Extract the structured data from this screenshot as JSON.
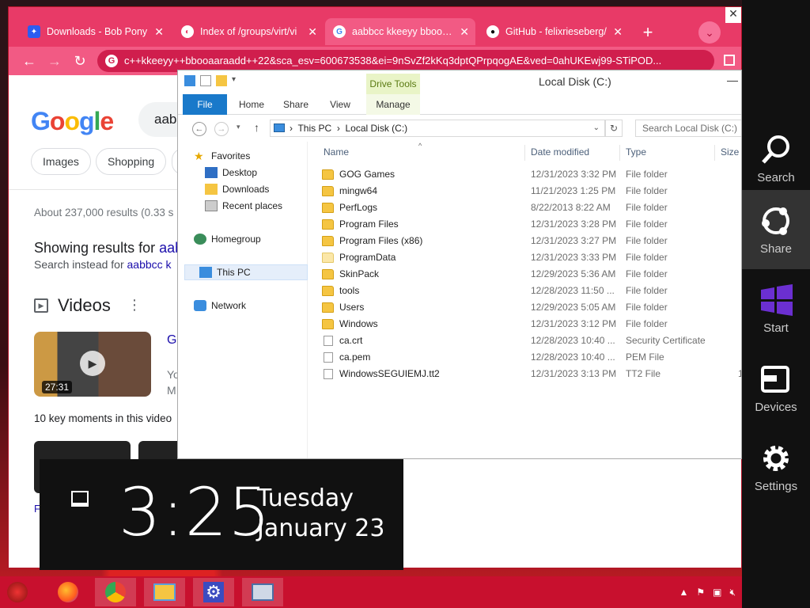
{
  "browser": {
    "tabs": [
      {
        "title": "Downloads - Bob Pony",
        "icon": "bob-pony-favicon"
      },
      {
        "title": "Index of /groups/virt/vi",
        "icon": "index-favicon"
      },
      {
        "title": "aabbcc kkeeyy bbooaar",
        "icon": "google-favicon",
        "active": true
      },
      {
        "title": "GitHub - felixrieseberg/",
        "icon": "github-favicon"
      }
    ],
    "new_tab_label": "+",
    "url": "c++kkeeyy++bbooaaraadd++22&sca_esv=600673538&ei=9nSvZf2kKq3dptQPrpqogAE&ved=0ahUKEwj99-STiPOD...",
    "accent_color": "#e83a67"
  },
  "google": {
    "logo": "Google",
    "search_value": "aabbcc kkeeyy bbooaar",
    "chips": [
      "Images",
      "Shopping"
    ],
    "result_stats": "About 237,000 results (0.33 s",
    "showing_prefix": "Showing results for ",
    "showing_query": "aab",
    "instead_prefix": "Search instead for ",
    "instead_query": "aabbcc k",
    "videos_heading": "Videos",
    "video_duration": "27:31",
    "video_title": "Ga",
    "video_line1": "Yo",
    "video_line2": "M",
    "key_moments": "10 key moments in this video",
    "footer_letter": "F"
  },
  "explorer": {
    "window_title": "Local Disk (C:)",
    "contextual_tab": "Drive Tools",
    "ribbon_tabs": [
      "File",
      "Home",
      "Share",
      "View",
      "Manage"
    ],
    "breadcrumb": [
      "This PC",
      "Local Disk (C:)"
    ],
    "search_placeholder": "Search Local Disk (C:)",
    "nav": {
      "favorites": "Favorites",
      "desktop": "Desktop",
      "downloads": "Downloads",
      "recent": "Recent places",
      "homegroup": "Homegroup",
      "thispc": "This PC",
      "network": "Network"
    },
    "columns": {
      "name": "Name",
      "date": "Date modified",
      "type": "Type",
      "size": "Size"
    },
    "files": [
      {
        "name": "GOG Games",
        "date": "12/31/2023 3:32 PM",
        "type": "File folder",
        "size": "",
        "kind": "folder"
      },
      {
        "name": "mingw64",
        "date": "11/21/2023 1:25 PM",
        "type": "File folder",
        "size": "",
        "kind": "folder"
      },
      {
        "name": "PerfLogs",
        "date": "8/22/2013 8:22 AM",
        "type": "File folder",
        "size": "",
        "kind": "folder"
      },
      {
        "name": "Program Files",
        "date": "12/31/2023 3:28 PM",
        "type": "File folder",
        "size": "",
        "kind": "folder"
      },
      {
        "name": "Program Files (x86)",
        "date": "12/31/2023 3:27 PM",
        "type": "File folder",
        "size": "",
        "kind": "folder"
      },
      {
        "name": "ProgramData",
        "date": "12/31/2023 3:33 PM",
        "type": "File folder",
        "size": "",
        "kind": "folder-hidden"
      },
      {
        "name": "SkinPack",
        "date": "12/29/2023 5:36 AM",
        "type": "File folder",
        "size": "",
        "kind": "folder"
      },
      {
        "name": "tools",
        "date": "12/28/2023 11:50 ...",
        "type": "File folder",
        "size": "",
        "kind": "folder"
      },
      {
        "name": "Users",
        "date": "12/29/2023 5:05 AM",
        "type": "File folder",
        "size": "",
        "kind": "folder"
      },
      {
        "name": "Windows",
        "date": "12/31/2023 3:12 PM",
        "type": "File folder",
        "size": "",
        "kind": "folder"
      },
      {
        "name": "ca.crt",
        "date": "12/28/2023 10:40 ...",
        "type": "Security Certificate",
        "size": "",
        "kind": "file"
      },
      {
        "name": "ca.pem",
        "date": "12/28/2023 10:40 ...",
        "type": "PEM File",
        "size": "",
        "kind": "file"
      },
      {
        "name": "WindowsSEGUIEMJ.tt2",
        "date": "12/31/2023 3:13 PM",
        "type": "TT2 File",
        "size": "1",
        "kind": "file"
      }
    ]
  },
  "clock": {
    "time": "3:25",
    "day": "Tuesday",
    "date": "January 23"
  },
  "charms": [
    {
      "label": "Search",
      "icon": "search-icon"
    },
    {
      "label": "Share",
      "icon": "share-icon",
      "hover": true
    },
    {
      "label": "Start",
      "icon": "windows-start-icon"
    },
    {
      "label": "Devices",
      "icon": "devices-icon"
    },
    {
      "label": "Settings",
      "icon": "gear-icon"
    }
  ],
  "taskbar": {
    "apps": [
      "firefox-icon",
      "chrome-icon",
      "file-explorer-icon",
      "settings-app-icon",
      "computer-app-icon"
    ],
    "color": "#c8102e"
  }
}
